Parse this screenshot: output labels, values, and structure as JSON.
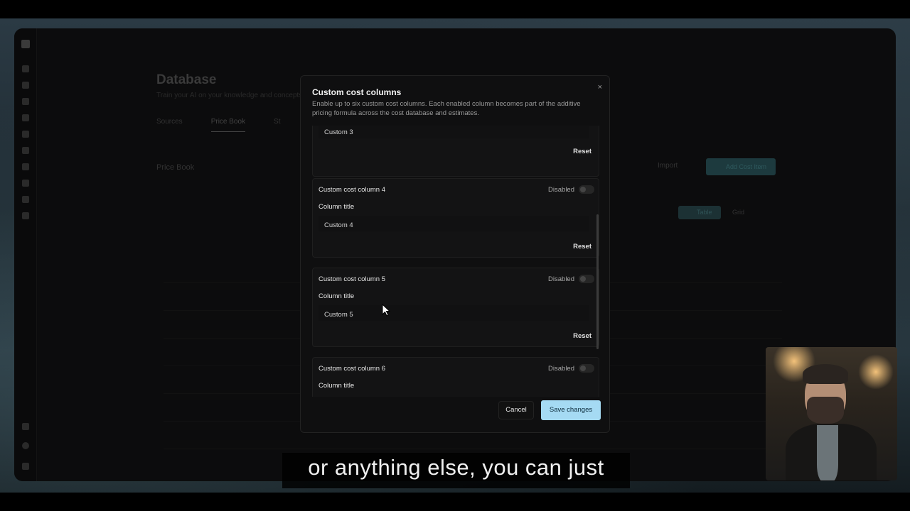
{
  "background_app": {
    "title": "Database",
    "subtitle": "Train your AI on your knowledge and concepts",
    "tabs": [
      "Sources",
      "Price Book",
      "St"
    ],
    "section_label": "Price Book",
    "import_label": "Import",
    "add_label": "Add Cost Item",
    "view_table": "Table",
    "view_grid": "Grid"
  },
  "modal": {
    "title": "Custom cost columns",
    "description": "Enable up to six custom cost columns. Each enabled column becomes part of the additive pricing formula across the cost database and estimates.",
    "close_glyph": "×",
    "partial_top": {
      "value": "Custom 3",
      "reset_label": "Reset"
    },
    "columns": [
      {
        "heading": "Custom cost column 4",
        "status": "Disabled",
        "field_label": "Column title",
        "value": "Custom 4",
        "reset_label": "Reset"
      },
      {
        "heading": "Custom cost column 5",
        "status": "Disabled",
        "field_label": "Column title",
        "value": "Custom 5",
        "reset_label": "Reset"
      },
      {
        "heading": "Custom cost column 6",
        "status": "Disabled",
        "field_label": "Column title"
      }
    ],
    "cancel_label": "Cancel",
    "save_label": "Save changes"
  },
  "subtitle_caption": "or anything else, you can just",
  "colors": {
    "accent": "#a5daf3",
    "modal_bg": "#0f0f10"
  }
}
